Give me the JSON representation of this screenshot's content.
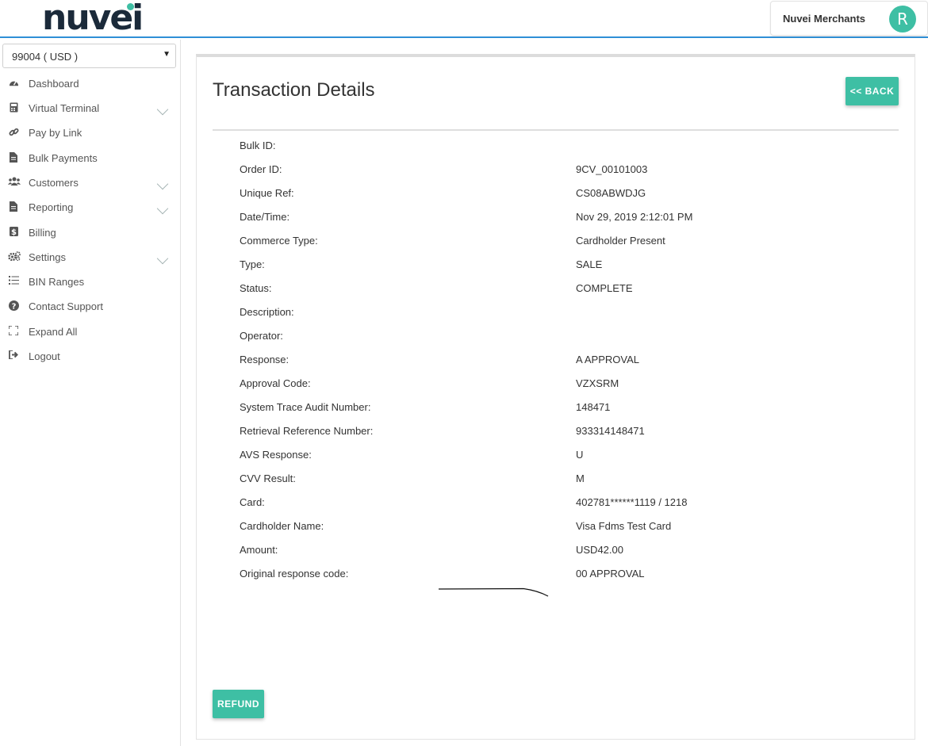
{
  "header": {
    "logo_text": "nuvei",
    "user_label": "Nuvei Merchants",
    "avatar_initial": "R",
    "accent_color": "#3ebfa4"
  },
  "sidebar": {
    "account_select": "99004 ( USD )",
    "items": [
      {
        "label": "Dashboard",
        "icon": "dashboard-icon",
        "expandable": false
      },
      {
        "label": "Virtual Terminal",
        "icon": "calculator-icon",
        "expandable": true
      },
      {
        "label": "Pay by Link",
        "icon": "link-icon",
        "expandable": false
      },
      {
        "label": "Bulk Payments",
        "icon": "file-icon",
        "expandable": false
      },
      {
        "label": "Customers",
        "icon": "users-icon",
        "expandable": true
      },
      {
        "label": "Reporting",
        "icon": "report-icon",
        "expandable": true
      },
      {
        "label": "Billing",
        "icon": "dollar-icon",
        "expandable": false
      },
      {
        "label": "Settings",
        "icon": "gears-icon",
        "expandable": true
      },
      {
        "label": "BIN Ranges",
        "icon": "list-icon",
        "expandable": false
      },
      {
        "label": "Contact Support",
        "icon": "question-icon",
        "expandable": false
      },
      {
        "label": "Expand All",
        "icon": "expand-icon",
        "expandable": false
      },
      {
        "label": "Logout",
        "icon": "logout-icon",
        "expandable": false
      }
    ]
  },
  "main": {
    "title": "Transaction Details",
    "back_label": "<< BACK",
    "refund_label": "REFUND",
    "details": [
      {
        "key": "Bulk ID:",
        "value": ""
      },
      {
        "key": "Order ID:",
        "value": "9CV_00101003"
      },
      {
        "key": "Unique Ref:",
        "value": "CS08ABWDJG"
      },
      {
        "key": "Date/Time:",
        "value": "Nov 29, 2019 2:12:01 PM"
      },
      {
        "key": "Commerce Type:",
        "value": "Cardholder Present"
      },
      {
        "key": "Type:",
        "value": "SALE"
      },
      {
        "key": "Status:",
        "value": "COMPLETE"
      },
      {
        "key": "Description:",
        "value": ""
      },
      {
        "key": "Operator:",
        "value": ""
      },
      {
        "key": "Response:",
        "value": "A APPROVAL"
      },
      {
        "key": "Approval Code:",
        "value": "VZXSRM"
      },
      {
        "key": "System Trace Audit Number:",
        "value": "148471"
      },
      {
        "key": "Retrieval Reference Number:",
        "value": "933314148471"
      },
      {
        "key": "AVS Response:",
        "value": "U"
      },
      {
        "key": "CVV Result:",
        "value": "M"
      },
      {
        "key": "Card:",
        "value": "402781******1119 / 1218"
      },
      {
        "key": "Cardholder Name:",
        "value": "Visa Fdms Test Card"
      },
      {
        "key": "Amount:",
        "value": "USD42.00"
      },
      {
        "key": "Original response code:",
        "value": "00 APPROVAL"
      }
    ]
  }
}
